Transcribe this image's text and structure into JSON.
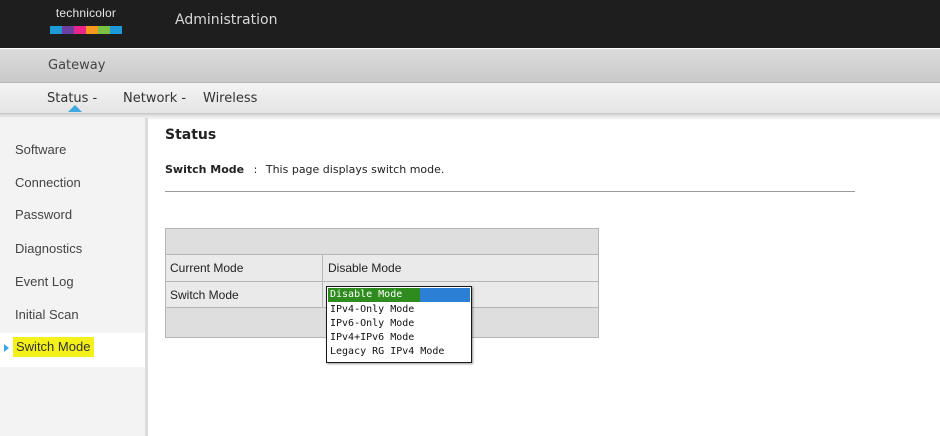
{
  "header": {
    "logo_text": "technicolor",
    "title": "Administration",
    "logo_colors": [
      "#1e9bd7",
      "#6c3fa0",
      "#e9258a",
      "#f39a1e",
      "#7ac143",
      "#1e9bd7"
    ]
  },
  "gateway_label": "Gateway",
  "nav": {
    "items": [
      {
        "label": "Status -",
        "active": true
      },
      {
        "label": "Network -",
        "active": false
      },
      {
        "label": "Wireless",
        "active": false
      }
    ],
    "accent_color": "#3ea8e0"
  },
  "sidebar": {
    "items": [
      {
        "label": "Software"
      },
      {
        "label": "Connection"
      },
      {
        "label": "Password"
      },
      {
        "label": "Diagnostics"
      },
      {
        "label": "Event Log"
      },
      {
        "label": "Initial Scan"
      },
      {
        "label": "Switch Mode",
        "active": true
      }
    ],
    "highlight_color": "#f4f01a"
  },
  "main": {
    "title": "Status",
    "description_key": "Switch Mode",
    "description_sep": ":",
    "description_text": "This page displays switch mode."
  },
  "table": {
    "rows": [
      {
        "label": "Current Mode",
        "value": "Disable Mode"
      },
      {
        "label": "Switch Mode",
        "value": "Disable Mode"
      }
    ]
  },
  "dropdown": {
    "selected": "Disable Mode",
    "options": [
      "Disable Mode",
      "IPv4-Only Mode",
      "IPv6-Only Mode",
      "IPv4+IPv6 Mode",
      "Legacy RG IPv4 Mode"
    ]
  }
}
